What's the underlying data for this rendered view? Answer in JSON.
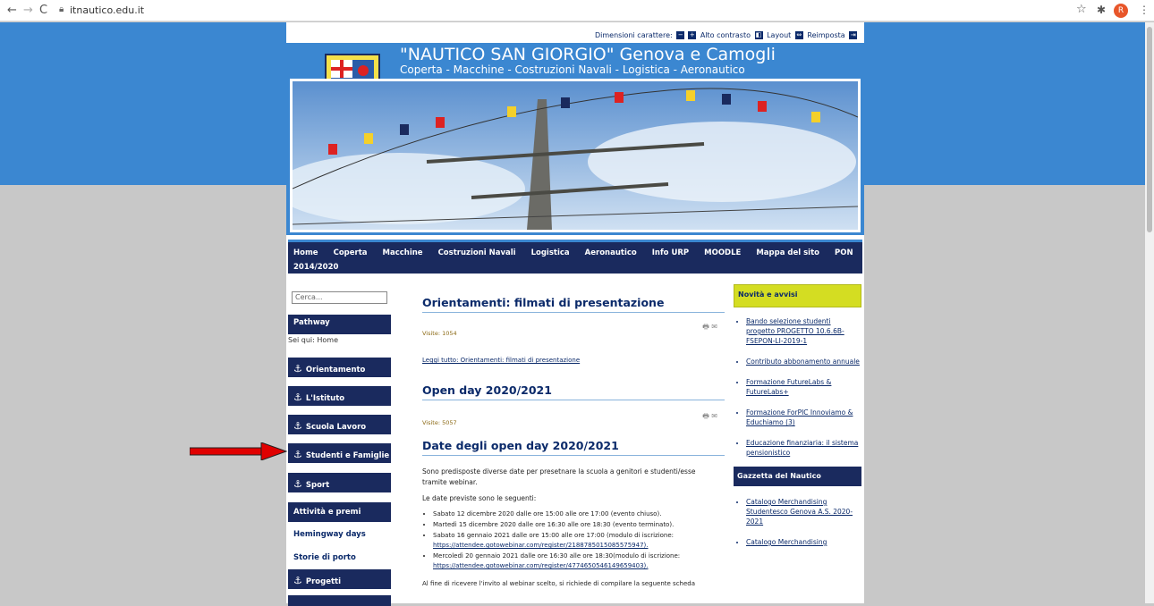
{
  "browser": {
    "url": "itnautico.edu.it",
    "profile_initial": "R"
  },
  "site": {
    "title": "\"NAUTICO SAN GIORGIO\" Genova e Camogli",
    "subtitle": "Coperta - Macchine - Costruzioni Navali - Logistica - Aeronautico",
    "tools": {
      "font_size_label": "Dimensioni carattere:",
      "contrast_label": "Alto contrasto",
      "layout_label": "Layout",
      "reset_label": "Reimposta"
    }
  },
  "menu": [
    "Home",
    "Coperta",
    "Macchine",
    "Costruzioni Navali",
    "Logistica",
    "Aeronautico",
    "Info URP",
    "MOODLE",
    "Mappa del sito",
    "PON"
  ],
  "menu_wrap": "2014/2020",
  "search": {
    "placeholder": "Cerca..."
  },
  "sidebar": {
    "pathway_title": "Pathway",
    "pathway_text": "Sei qui: Home",
    "items": [
      "Orientamento",
      "L'Istituto",
      "Scuola Lavoro",
      "Studenti e Famiglie",
      "Sport"
    ],
    "attivita": "Attività e premi",
    "hemingway": "Hemingway days",
    "storie": "Storie di porto",
    "progetti": "Progetti"
  },
  "main": {
    "article1_title": "Orientamenti: filmati di presentazione",
    "article1_visits": "Visite: 1054",
    "article1_more": "Leggi tutto: Orientamenti: filmati di presentazione",
    "article2_title": "Open day 2020/2021",
    "article2_visits": "Visite: 5057",
    "article3_title": "Date degli open day 2020/2021",
    "intro1": "Sono predisposte diverse date per presetnare la scuola a genitori e studenti/esse tramite webinar.",
    "intro2": "Le date previste sono le seguenti:",
    "dates": [
      {
        "text": "Sabato 12 dicembre 2020 dalle ore 15:00 alle ore 17:00 (evento chiuso).",
        "link": ""
      },
      {
        "text": "Martedì 15 dicembre 2020 dalle ore 16:30 alle ore 18:30 (evento terminato).",
        "link": ""
      },
      {
        "text": "Sabato 16 gennaio 2021 dalle ore 15:00 alle ore 17:00 (modulo di iscrizione:",
        "link": "https://attendee.gotowebinar.com/register/2188785015085575947)."
      },
      {
        "text": "Mercoledì 20 gennaio 2021 dalle ore 16:30 alle ore 18:30(modulo di iscrizione:",
        "link": "https://attendee.gotowebinar.com/register/4774650546149659403)."
      }
    ],
    "footer_cut": "Al fine di ricevere l'invito al webinar scelto, si richiede di compilare la seguente scheda"
  },
  "right": {
    "news_title": "Novità e avvisi",
    "news": [
      "Bando selezione studenti progetto PROGETTO 10.6.6B-FSEPON-LI-2019-1",
      "Contributo abbonamento annuale",
      "Formazione FutureLabs & FutureLabs+",
      "Formazione ForPIC Innoviamo & Educhiamo (3)",
      "Educazione finanziaria: il sistema pensionistico"
    ],
    "gazette_title": "Gazzetta del Nautico",
    "gazette": [
      "Catalogo Merchandising Studentesco Genova A.S. 2020-2021",
      "Catalogo Merchandising"
    ]
  },
  "colors": {
    "brand_blue": "#3b87d1",
    "navy": "#1a2a5e",
    "news_yellow": "#d4dd22",
    "arrow_red": "#e00000"
  }
}
